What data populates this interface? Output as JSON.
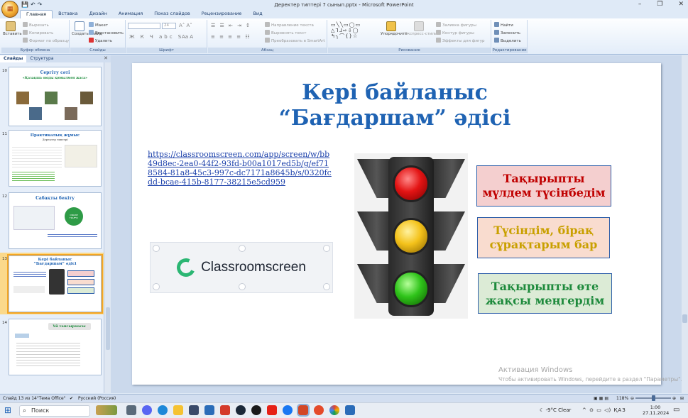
{
  "window": {
    "title": "Деректер типтері 7 сынып.pptx - Microsoft PowerPoint",
    "controls": [
      "–",
      "❐",
      "✕"
    ]
  },
  "qat": [
    "💾",
    "↶",
    "↷"
  ],
  "tabs": [
    "Главная",
    "Вставка",
    "Дизайн",
    "Анимация",
    "Показ слайдов",
    "Рецензирование",
    "Вид"
  ],
  "ribbon": {
    "clipboard": {
      "label": "Буфер обмена",
      "paste": "Вставить",
      "cut": "Вырезать",
      "copy": "Копировать",
      "format_painter": "Формат по образцу"
    },
    "slides": {
      "label": "Слайды",
      "new_slide": "Создать слайд",
      "layout": "Макет",
      "reset": "Восстановить",
      "delete": "Удалить"
    },
    "font": {
      "label": "Шрифт",
      "font_size": "24"
    },
    "paragraph": {
      "label": "Абзац",
      "text_direction": "Направление текста",
      "align_text": "Выровнять текст",
      "smartart": "Преобразовать в SmartArt"
    },
    "drawing": {
      "label": "Рисование",
      "arrange": "Упорядочить",
      "quick_styles": "Экспресс-стили",
      "shape_fill": "Заливка фигуры",
      "shape_outline": "Контур фигуры",
      "shape_effects": "Эффекты для фигур"
    },
    "editing": {
      "label": "Редактирование",
      "find": "Найти",
      "replace": "Заменить",
      "select": "Выделить"
    }
  },
  "pane": {
    "tab_slides": "Слайды",
    "tab_outline": "Структура",
    "close": "✕",
    "thumbnails": [
      {
        "num": "10",
        "title": "Сергіту сәті",
        "subtitle": "«Қазақша оюды қимылмен жаса»"
      },
      {
        "num": "11",
        "title": "Практикалық жұмыс",
        "subtitle": "Деректер типтері"
      },
      {
        "num": "12",
        "title": "Сабақты бекіту",
        "subtitle": "",
        "badge": "ONLINE\nTRAFFIC"
      },
      {
        "num": "13",
        "title": "Кері байланыс\n“Бағдаршам” әдісі",
        "subtitle": ""
      },
      {
        "num": "14",
        "title": "Үй тапсырмасы",
        "subtitle": ""
      }
    ]
  },
  "slide": {
    "title_line1": "Кері байланыс",
    "title_line2": "“Бағдаршам” әдісі",
    "link": "https://classroomscreen.com/app/screen/w/bb49d8ec-2ea0-44f2-93fd-b00a1017ed5b/g/ef718584-81a8-45c3-997c-dc7171a8645b/s/0320fcdd-bcae-415b-8177-38215e5cd959",
    "logo_name": "Classroomscreen",
    "label_red": "Тақырыпты мүлдем түсінбедім",
    "label_yellow": "Түсіндім, бірақ сұрақтарым бар",
    "label_green": "Тақырыпты өте жақсы меңгердім"
  },
  "watermark": {
    "line1": "Активация Windows",
    "line2": "Чтобы активировать Windows, перейдите в раздел \"Параметры\"."
  },
  "status": {
    "slide_counter": "Слайд 13 из 14",
    "theme": "\"Тема Office\"",
    "language": "Русский (Россия)",
    "zoom": "118%"
  },
  "taskbar": {
    "search_placeholder": "Поиск",
    "weather": "-9°C  Clear",
    "lang": "ҚАЗ",
    "time": "1:00",
    "date": "27.11.2024"
  },
  "colors": {
    "title_blue": "#1f63b3",
    "red_text": "#c00000",
    "yellow_text": "#c9a000",
    "green_text": "#1e8a3c",
    "accent_orange": "#f5a623"
  }
}
